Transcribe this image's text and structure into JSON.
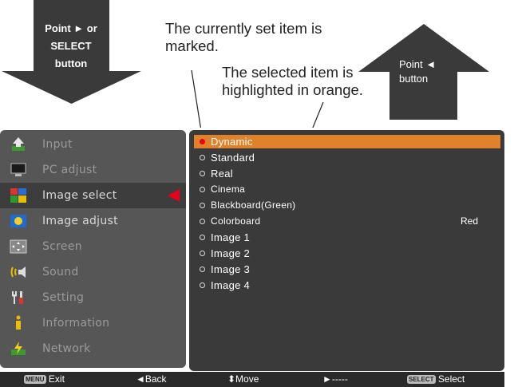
{
  "callouts": {
    "point_or_select": [
      "Point ► or",
      "SELECT",
      "button"
    ],
    "point_left": [
      "Point ◄",
      "button"
    ],
    "currently_set": [
      "The currently set item is",
      "marked."
    ],
    "highlighted": [
      "The selected item is",
      "highlighted in orange."
    ]
  },
  "menu": {
    "items": [
      {
        "label": "Input",
        "icon": "input-icon"
      },
      {
        "label": "PC adjust",
        "icon": "pc-adjust-icon"
      },
      {
        "label": "Image select",
        "icon": "image-select-icon"
      },
      {
        "label": "Image adjust",
        "icon": "image-adjust-icon"
      },
      {
        "label": "Screen",
        "icon": "screen-icon"
      },
      {
        "label": "Sound",
        "icon": "sound-icon"
      },
      {
        "label": "Setting",
        "icon": "setting-icon"
      },
      {
        "label": "Information",
        "icon": "information-icon"
      },
      {
        "label": "Network",
        "icon": "network-icon"
      }
    ],
    "active_index": 2
  },
  "submenu": {
    "options": [
      {
        "label": "Dynamic",
        "selected": true
      },
      {
        "label": "Standard"
      },
      {
        "label": "Real"
      },
      {
        "label": "Cinema"
      },
      {
        "label": "Blackboard(Green)"
      },
      {
        "label": "Colorboard",
        "value": "Red"
      },
      {
        "label": "Image 1"
      },
      {
        "label": "Image 2"
      },
      {
        "label": "Image 3"
      },
      {
        "label": "Image 4"
      }
    ]
  },
  "footer": {
    "menu_key": "MENU",
    "exit": "Exit",
    "back": "◄Back",
    "move": "⬍Move",
    "right": "►-----",
    "select_key": "SELECT",
    "select": "Select"
  },
  "colors": {
    "highlight": "#e0812c",
    "marker": "#e8001c"
  }
}
